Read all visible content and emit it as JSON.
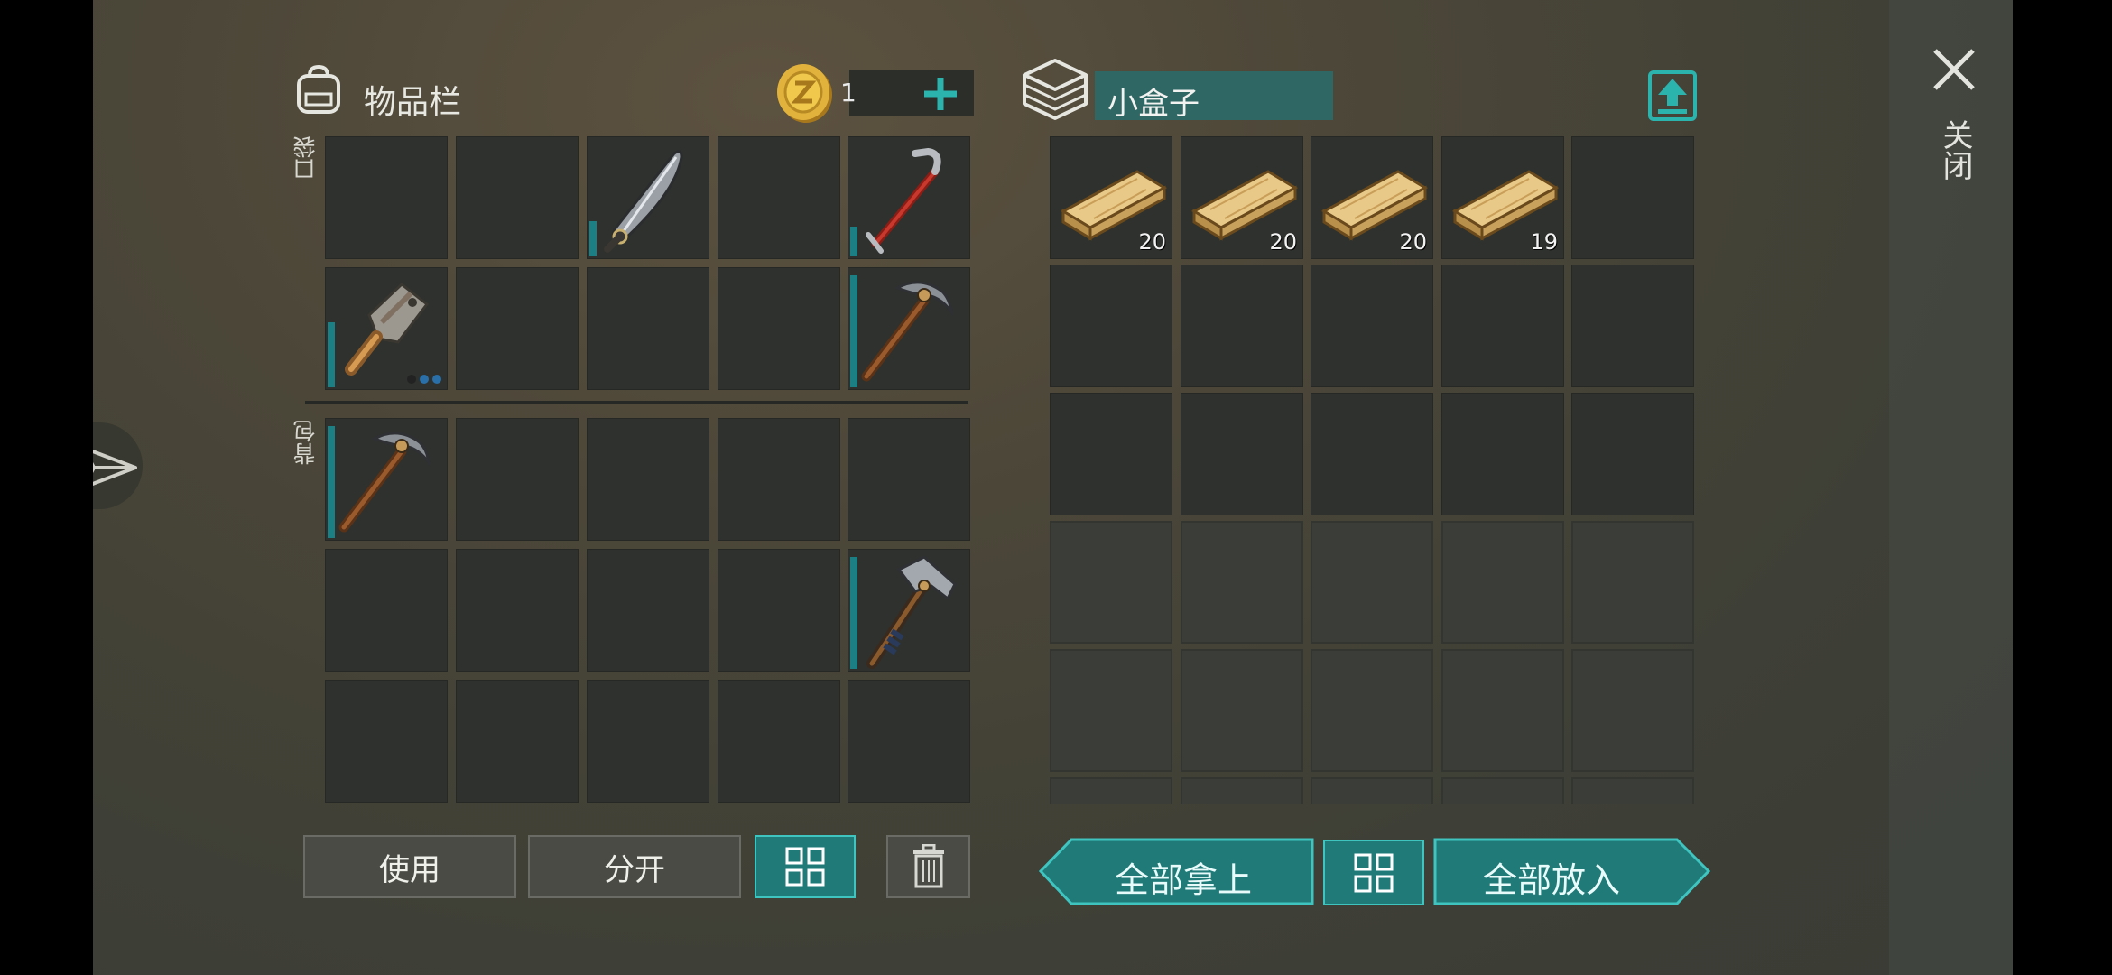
{
  "inventory": {
    "title": "物品栏",
    "currency_amount": "1",
    "pocket_label": "口袋",
    "backpack_label": "背包",
    "pocket_slots": [
      {
        "item": ""
      },
      {
        "item": ""
      },
      {
        "item": "machete",
        "durability": 0.3
      },
      {
        "item": ""
      },
      {
        "item": "crowbar",
        "durability": 0.25
      },
      {
        "item": "cleaver",
        "durability": 0.55
      },
      {
        "item": ""
      },
      {
        "item": ""
      },
      {
        "item": ""
      },
      {
        "item": "pickaxe",
        "durability": 0.95
      }
    ],
    "backpack_slots": [
      {
        "item": "pickaxe",
        "durability": 0.95
      },
      {
        "item": ""
      },
      {
        "item": ""
      },
      {
        "item": ""
      },
      {
        "item": ""
      },
      {
        "item": ""
      },
      {
        "item": ""
      },
      {
        "item": ""
      },
      {
        "item": ""
      },
      {
        "item": "hammer",
        "durability": 0.95
      },
      {
        "item": ""
      },
      {
        "item": ""
      },
      {
        "item": ""
      },
      {
        "item": ""
      },
      {
        "item": ""
      }
    ],
    "buttons": {
      "use": "使用",
      "split": "分开"
    }
  },
  "container": {
    "name": "小盒子",
    "slots": [
      {
        "item": "wood-plank",
        "count": "20"
      },
      {
        "item": "wood-plank",
        "count": "20"
      },
      {
        "item": "wood-plank",
        "count": "20"
      },
      {
        "item": "wood-plank",
        "count": "19"
      }
    ],
    "buttons": {
      "take_all": "全部拿上",
      "put_all": "全部放入"
    }
  },
  "close_label": "关闭",
  "icons": {
    "backpack": "backpack-icon",
    "coin": "coin-icon",
    "add": "plus-icon",
    "box": "box-icon",
    "transfer": "upload-icon",
    "sort": "grid-sort-icon",
    "trash": "trash-icon",
    "close": "close-icon",
    "send": "send-icon"
  },
  "colors": {
    "accent": "#1f7a78",
    "accent_border": "#3fc4c0",
    "slot": "#2e312d",
    "durability": "#1c7f83"
  }
}
